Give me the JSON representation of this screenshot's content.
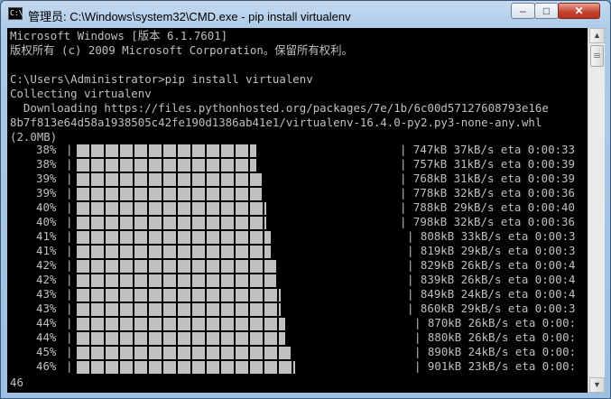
{
  "window": {
    "title": "管理员: C:\\Windows\\system32\\CMD.exe - pip  install virtualenv",
    "icon_text": "C:\\",
    "controls": {
      "minimize": "–",
      "maximize": "□",
      "close": "✕"
    }
  },
  "console": {
    "header": [
      "Microsoft Windows [版本 6.1.7601]",
      "版权所有 (c) 2009 Microsoft Corporation。保留所有权利。",
      "",
      "C:\\Users\\Administrator>pip install virtualenv",
      "Collecting virtualenv",
      "  Downloading https://files.pythonhosted.org/packages/7e/1b/6c00d57127608793e16e",
      "8b7f813e64d58a1938505c42fe190d1386ab41e1/virtualenv-16.4.0-py2.py3-none-any.whl",
      "(2.0MB)"
    ],
    "progress_rows": [
      {
        "percent": "38%",
        "stats": "| 747kB 37kB/s eta 0:00:33",
        "progress": 0.38
      },
      {
        "percent": "38%",
        "stats": "| 757kB 31kB/s eta 0:00:39",
        "progress": 0.38
      },
      {
        "percent": "39%",
        "stats": "| 768kB 31kB/s eta 0:00:39",
        "progress": 0.39
      },
      {
        "percent": "39%",
        "stats": "| 778kB 32kB/s eta 0:00:36",
        "progress": 0.39
      },
      {
        "percent": "40%",
        "stats": "| 788kB 29kB/s eta 0:00:40",
        "progress": 0.4
      },
      {
        "percent": "40%",
        "stats": "| 798kB 32kB/s eta 0:00:36",
        "progress": 0.4
      },
      {
        "percent": "41%",
        "stats": "| 808kB 33kB/s eta 0:00:3",
        "progress": 0.41
      },
      {
        "percent": "41%",
        "stats": "| 819kB 29kB/s eta 0:00:3",
        "progress": 0.41
      },
      {
        "percent": "42%",
        "stats": "| 829kB 26kB/s eta 0:00:4",
        "progress": 0.42
      },
      {
        "percent": "42%",
        "stats": "| 839kB 26kB/s eta 0:00:4",
        "progress": 0.42
      },
      {
        "percent": "43%",
        "stats": "| 849kB 24kB/s eta 0:00:4",
        "progress": 0.43
      },
      {
        "percent": "43%",
        "stats": "| 860kB 29kB/s eta 0:00:3",
        "progress": 0.43
      },
      {
        "percent": "44%",
        "stats": "| 870kB 26kB/s eta 0:00:",
        "progress": 0.44
      },
      {
        "percent": "44%",
        "stats": "| 880kB 26kB/s eta 0:00:",
        "progress": 0.44
      },
      {
        "percent": "45%",
        "stats": "| 890kB 24kB/s eta 0:00:",
        "progress": 0.45
      },
      {
        "percent": "46%",
        "stats": "| 901kB 23kB/s eta 0:00:",
        "progress": 0.46
      }
    ],
    "bar_left": "|",
    "last_line": "46"
  },
  "scrollbar": {
    "up_arrow": "▲",
    "down_arrow": "▼"
  }
}
